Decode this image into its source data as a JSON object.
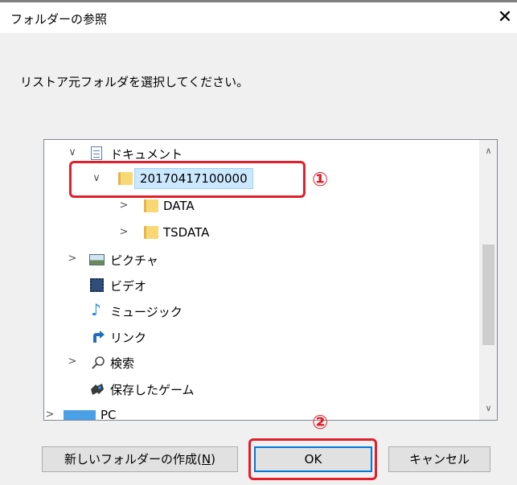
{
  "dialog": {
    "title": "フォルダーの参照",
    "close_glyph": "✕",
    "instruction": "リストア元フォルダを選択してください。"
  },
  "tree": {
    "items": [
      {
        "label": "ドキュメント",
        "chevron": "∨",
        "icon": "documents-icon"
      },
      {
        "label": "20170417100000",
        "chevron": "∨",
        "icon": "folder-icon",
        "selected": true
      },
      {
        "label": "DATA",
        "chevron": ">",
        "icon": "folder-icon"
      },
      {
        "label": "TSDATA",
        "chevron": ">",
        "icon": "folder-icon"
      },
      {
        "label": "ピクチャ",
        "chevron": ">",
        "icon": "pictures-icon"
      },
      {
        "label": "ビデオ",
        "chevron": "",
        "icon": "videos-icon"
      },
      {
        "label": "ミュージック",
        "chevron": "",
        "icon": "music-icon"
      },
      {
        "label": "リンク",
        "chevron": "",
        "icon": "links-icon"
      },
      {
        "label": "検索",
        "chevron": ">",
        "icon": "search-icon"
      },
      {
        "label": "保存したゲーム",
        "chevron": "",
        "icon": "saved-games-icon"
      },
      {
        "label": "PC",
        "chevron": ">",
        "icon": "pc-icon"
      }
    ],
    "scroll_up_glyph": "∧",
    "scroll_down_glyph": "∨"
  },
  "annotations": {
    "callout_1": "①",
    "callout_2": "②",
    "highlight_color": "#e0202a"
  },
  "buttons": {
    "new_folder_label": "新しいフォルダーの作成(",
    "new_folder_accel": "N",
    "new_folder_close": ")",
    "ok_label": "OK",
    "cancel_label": "キャンセル"
  },
  "colors": {
    "dialog_bg": "#f0f0f0",
    "selection_bg": "#cce8ff",
    "accent": "#0078d7"
  }
}
